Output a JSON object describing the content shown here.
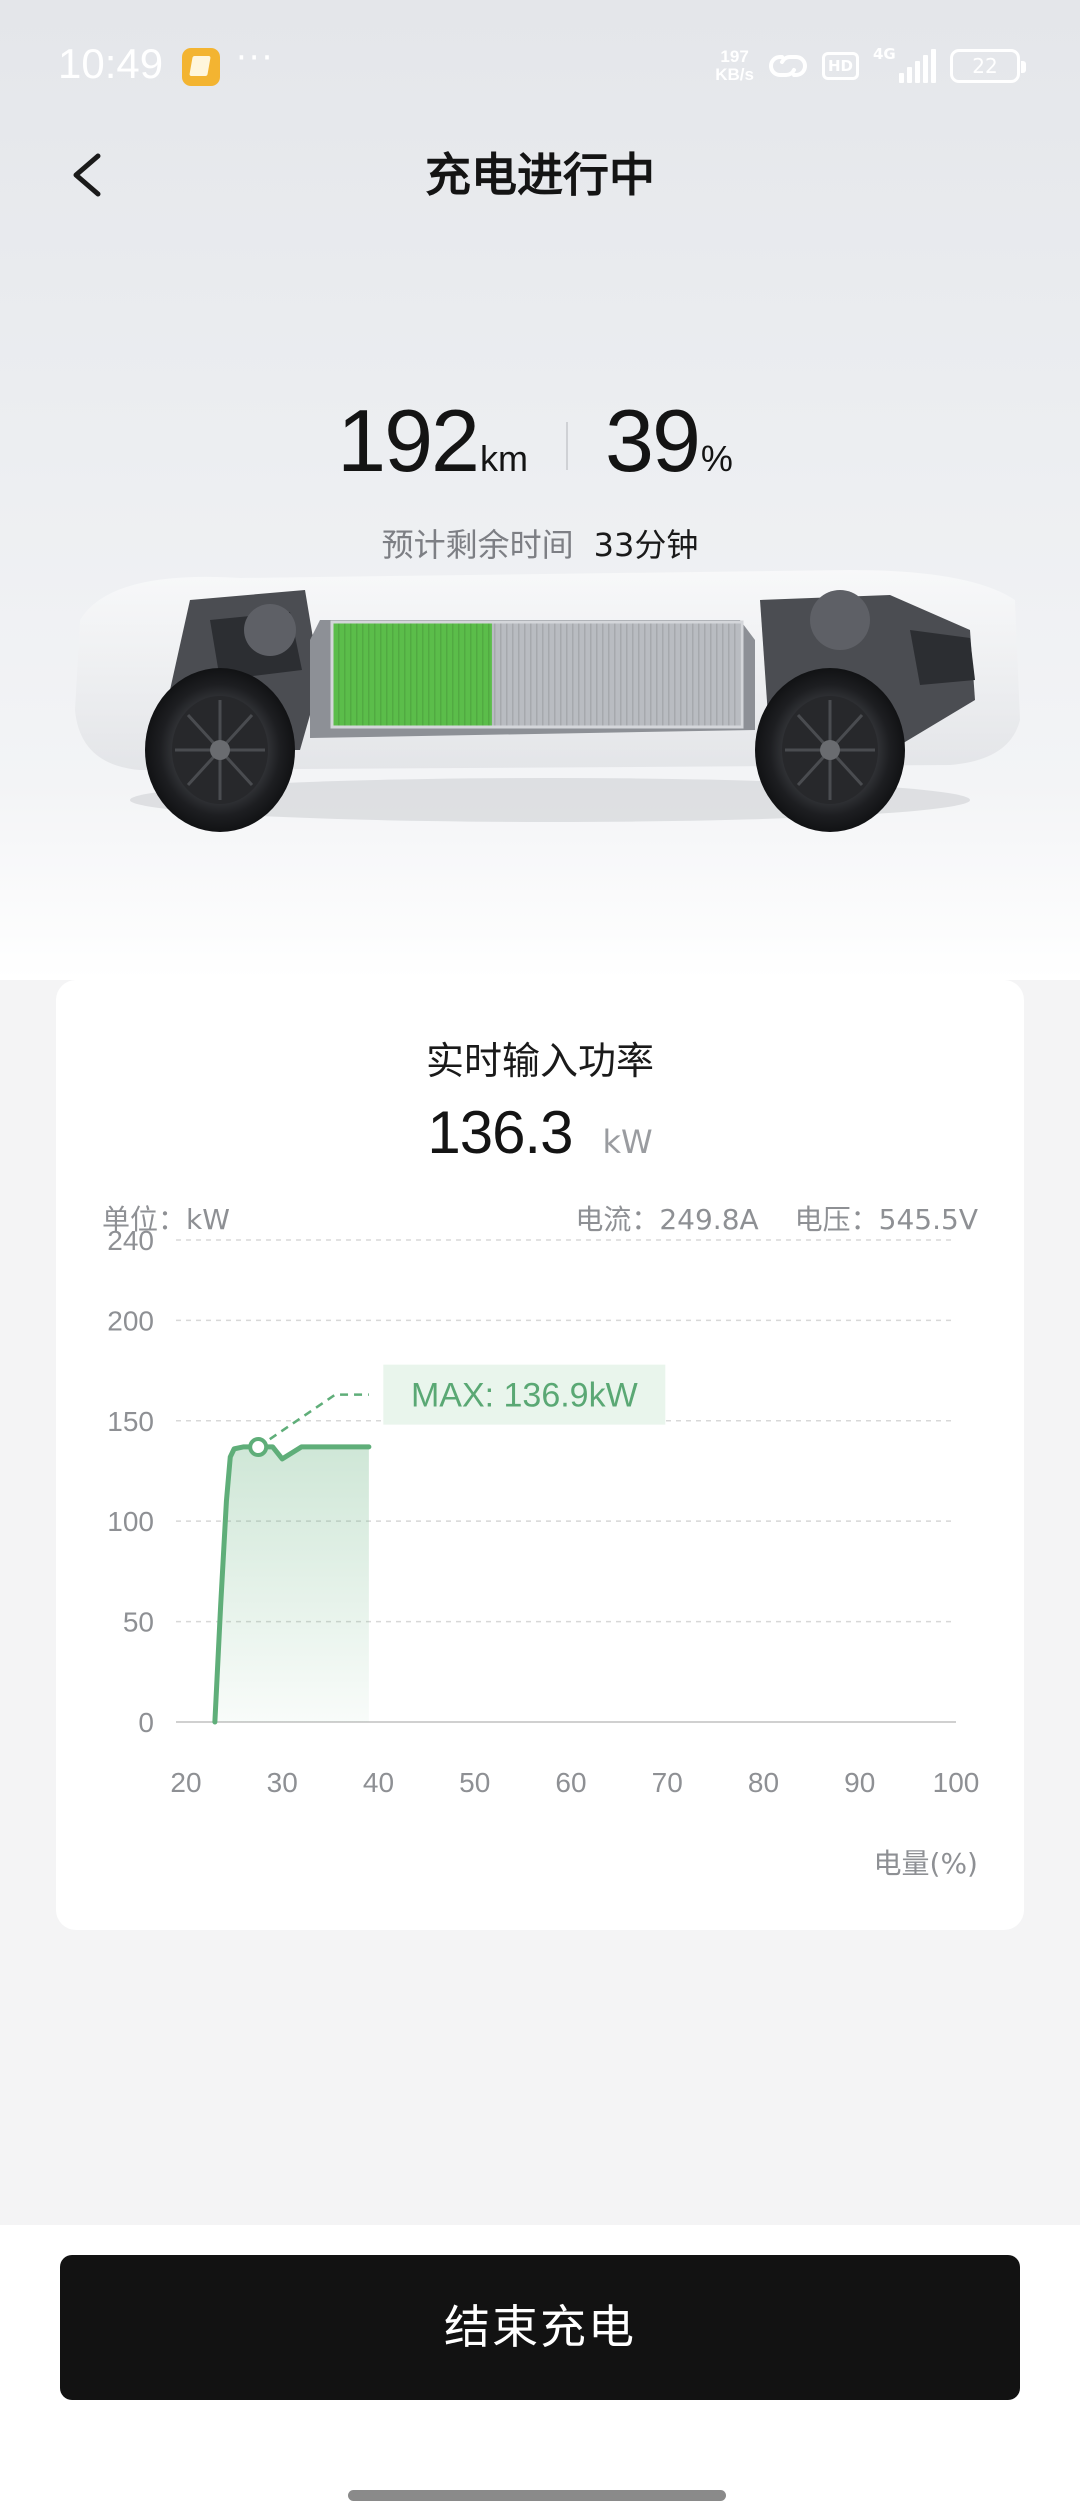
{
  "status_bar": {
    "time": "10:49",
    "menu_icon": "more-dots-icon",
    "speed_value": "197",
    "speed_unit": "KB/s",
    "hd": "HD",
    "network": "4G",
    "battery": "22"
  },
  "header": {
    "title": "充电进行中"
  },
  "summary": {
    "range_value": "192",
    "range_unit": "km",
    "soc_value": "39",
    "soc_unit": "%",
    "eta_label": "预计剩余时间",
    "eta_value": "33分钟",
    "battery_fill_fraction": 0.39
  },
  "power_card": {
    "title": "实时输入功率",
    "power_value": "136.3",
    "power_unit": "kW",
    "unit_label": "单位：kW",
    "current": "电流：249.8A",
    "voltage": "电压：545.5V",
    "x_unit_label": "电量(%)",
    "max_label": "MAX: 136.9kW"
  },
  "chart_data": {
    "type": "area",
    "title": "",
    "xlabel": "电量(%)",
    "ylabel": "单位：kW",
    "xlim": [
      20,
      100
    ],
    "ylim": [
      0,
      240
    ],
    "y_ticks": [
      0,
      50,
      100,
      150,
      200,
      240
    ],
    "x_ticks": [
      20,
      30,
      40,
      50,
      60,
      70,
      80,
      90,
      100
    ],
    "grid": true,
    "colors": {
      "line": "#5fae79",
      "fill": "#5fae79",
      "grid": "#d8d8d8",
      "max_bg": "#e9f5ec",
      "max_text": "#5aa874"
    },
    "series": [
      {
        "x": [
          23,
          23.6,
          24.2,
          24.6,
          25.0,
          26.0,
          27.0,
          28.0,
          29.0,
          30.0,
          31.0,
          32.0,
          33.0,
          34.0,
          36.0,
          38.0,
          39.0
        ],
        "y": [
          0,
          58,
          110,
          132,
          136,
          137,
          137,
          137,
          137,
          131,
          134,
          137,
          137,
          137,
          137,
          137,
          137
        ]
      }
    ],
    "max_point": {
      "x": 27.5,
      "y": 136.9
    },
    "projection": {
      "x": [
        27.5,
        35.5,
        39.0
      ],
      "y": [
        136.9,
        163,
        163
      ]
    }
  },
  "footer": {
    "end_button": "结束充电"
  }
}
